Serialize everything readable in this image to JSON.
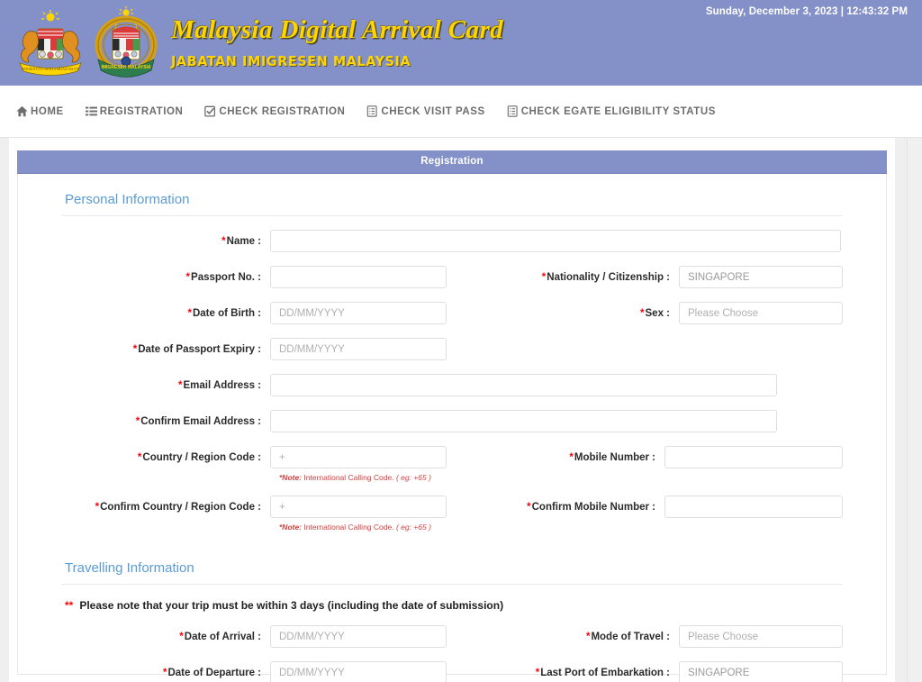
{
  "header": {
    "title_main": "Malaysia Digital Arrival Card",
    "title_sub": "JABATAN IMIGRESEN MALAYSIA",
    "datetime": "Sunday, December 3, 2023 | 12:43:32 PM",
    "banner_color": "#8490c8",
    "title_color": "#ffd400"
  },
  "nav": {
    "items": [
      {
        "label": "HOME",
        "icon": "home-icon"
      },
      {
        "label": "REGISTRATION",
        "icon": "list-icon"
      },
      {
        "label": "CHECK REGISTRATION",
        "icon": "check-square-icon"
      },
      {
        "label": "CHECK VISIT PASS",
        "icon": "list-alt-icon"
      },
      {
        "label": "CHECK EGATE ELIGIBILITY STATUS",
        "icon": "list-alt-icon"
      }
    ]
  },
  "panel": {
    "title": "Registration"
  },
  "personal": {
    "section_title": "Personal Information",
    "name": {
      "label": "Name :",
      "value": "",
      "placeholder": ""
    },
    "passport_no": {
      "label": "Passport No. :",
      "value": "",
      "placeholder": ""
    },
    "nationality": {
      "label": "Nationality / Citizenship :",
      "value": "SINGAPORE",
      "placeholder": ""
    },
    "date_of_birth": {
      "label": "Date of Birth :",
      "value": "",
      "placeholder": "DD/MM/YYYY"
    },
    "sex": {
      "label": "Sex :",
      "value": "Please Choose",
      "placeholder": "Please Choose"
    },
    "passport_expiry": {
      "label": "Date of Passport Expiry :",
      "value": "",
      "placeholder": "DD/MM/YYYY"
    },
    "email": {
      "label": "Email Address :",
      "value": "",
      "placeholder": ""
    },
    "confirm_email": {
      "label": "Confirm Email Address :",
      "value": "",
      "placeholder": ""
    },
    "country_code": {
      "label": "Country / Region Code :",
      "value": "",
      "placeholder": "+"
    },
    "mobile_number": {
      "label": "Mobile Number :",
      "value": "",
      "placeholder": ""
    },
    "confirm_country_code": {
      "label": "Confirm Country / Region Code :",
      "value": "",
      "placeholder": "+"
    },
    "confirm_mobile_number": {
      "label": "Confirm Mobile Number :",
      "value": "",
      "placeholder": ""
    },
    "note_label": "*Note:",
    "note_text": " International Calling Code.",
    "note_example": " ( eg: +65 )"
  },
  "travelling": {
    "section_title": "Travelling Information",
    "warning_stars": "**",
    "warning_text": "Please note that your trip must be within 3 days (including the date of submission)",
    "date_of_arrival": {
      "label": "Date of Arrival :",
      "value": "",
      "placeholder": "DD/MM/YYYY"
    },
    "mode_of_travel": {
      "label": "Mode of Travel :",
      "value": "Please Choose",
      "placeholder": "Please Choose"
    },
    "date_of_departure": {
      "label": "Date of Departure :",
      "value": "",
      "placeholder": "DD/MM/YYYY"
    },
    "last_port": {
      "label": "Last Port of Embarkation :",
      "value": "SINGAPORE",
      "placeholder": ""
    }
  }
}
